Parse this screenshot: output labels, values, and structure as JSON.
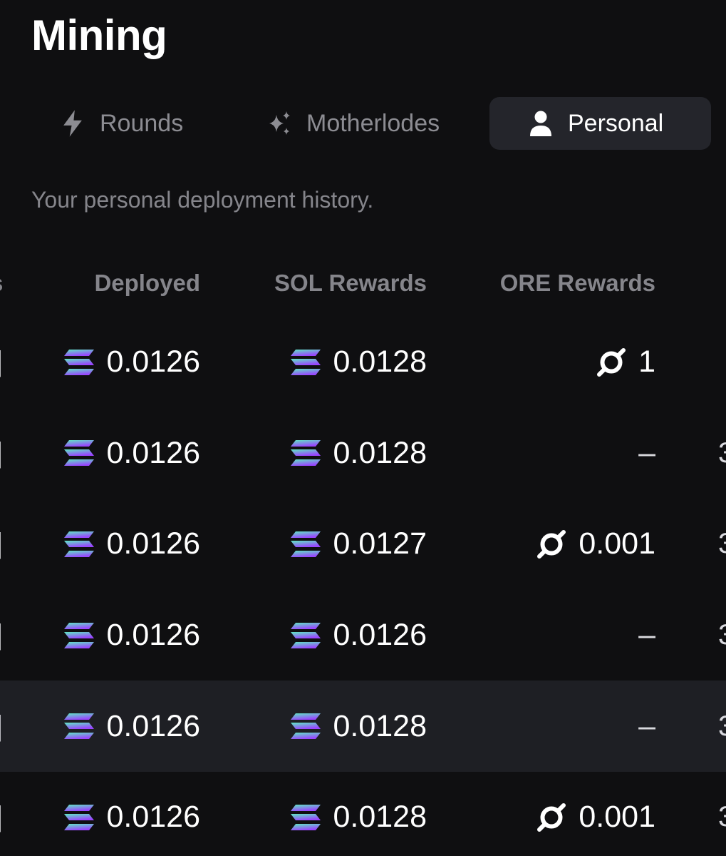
{
  "page": {
    "title": "Mining",
    "subtitle": "Your personal deployment history."
  },
  "tabs": [
    {
      "label": "Rounds",
      "icon": "lightning-icon",
      "active": false
    },
    {
      "label": "Motherlodes",
      "icon": "sparkles-icon",
      "active": false
    },
    {
      "label": "Personal",
      "icon": "user-icon",
      "active": true
    }
  ],
  "table": {
    "columns": [
      "Deployed",
      "SOL Rewards",
      "ORE Rewards"
    ],
    "rows": [
      {
        "deployed": "0.0126",
        "sol_rewards": "0.0128",
        "ore_rewards": "1",
        "ore_has_icon": true,
        "highlighted": false
      },
      {
        "deployed": "0.0126",
        "sol_rewards": "0.0128",
        "ore_rewards": "–",
        "ore_has_icon": false,
        "highlighted": false
      },
      {
        "deployed": "0.0126",
        "sol_rewards": "0.0127",
        "ore_rewards": "0.001",
        "ore_has_icon": true,
        "highlighted": false
      },
      {
        "deployed": "0.0126",
        "sol_rewards": "0.0126",
        "ore_rewards": "–",
        "ore_has_icon": false,
        "highlighted": false
      },
      {
        "deployed": "0.0126",
        "sol_rewards": "0.0128",
        "ore_rewards": "–",
        "ore_has_icon": false,
        "highlighted": true
      },
      {
        "deployed": "0.0126",
        "sol_rewards": "0.0128",
        "ore_rewards": "0.001",
        "ore_has_icon": true,
        "highlighted": false
      }
    ]
  },
  "colors": {
    "background": "#0f0f11",
    "active_tab": "#24252b",
    "highlight_row": "#1e1f24",
    "muted_text": "#85858b",
    "sol_gradient_top": "#5ee9c2",
    "sol_gradient_bottom": "#9945ff"
  }
}
